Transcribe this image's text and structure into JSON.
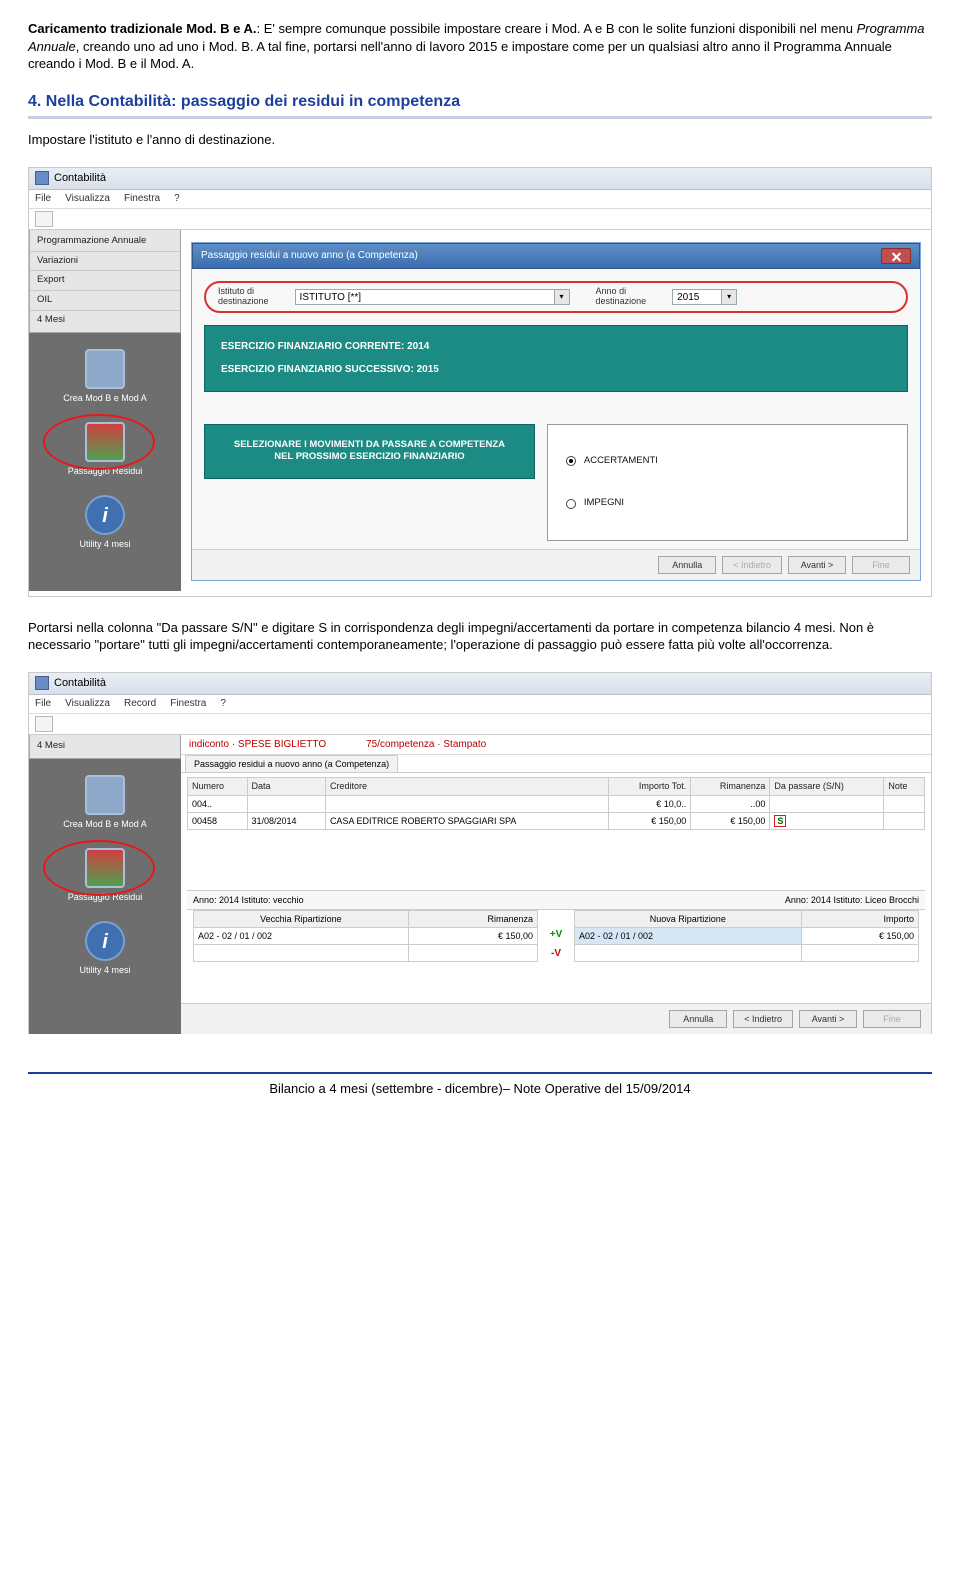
{
  "intro": {
    "strong": "Caricamento tradizionale Mod. B e A.",
    "text1": ": E' sempre comunque possibile impostare creare i Mod. A e B con le solite funzioni disponibili nel menu ",
    "em": "Programma Annuale",
    "text2": ", creando uno ad uno i Mod. B. A tal fine, portarsi nell'anno di lavoro 2015 e impostare come per un qualsiasi altro anno il Programma Annuale creando i Mod. B e il Mod. A."
  },
  "section": {
    "title": "4. Nella Contabilità: passaggio dei residui in competenza",
    "lead": "Impostare l'istituto e l'anno di destinazione."
  },
  "shot1": {
    "app_title": "Contabilità",
    "menu": [
      "File",
      "Visualizza",
      "Finestra",
      "?"
    ],
    "leftmenu": [
      "Programmazione Annuale",
      "Variazioni",
      "Export",
      "OIL",
      "4 Mesi"
    ],
    "sidebar": {
      "crea_label": "Crea Mod B e Mod A",
      "passaggio_label": "Passaggio Residui",
      "utility_label": "Utility 4 mesi"
    },
    "dialog": {
      "title": "Passaggio residui a nuovo anno (a Competenza)",
      "fld_ist_lbl": "Istituto di\ndestinazione",
      "fld_ist_val": "ISTITUTO [**]",
      "fld_anno_lbl": "Anno di\ndestinazione",
      "fld_anno_val": "2015",
      "teal1a": "ESERCIZIO FINANZIARIO CORRENTE: 2014",
      "teal1b": "ESERCIZIO FINANZIARIO SUCCESSIVO: 2015",
      "teal2a": "SELEZIONARE I MOVIMENTI DA PASSARE A COMPETENZA",
      "teal2b": "NEL PROSSIMO ESERCIZIO FINANZIARIO",
      "radio1": "ACCERTAMENTI",
      "radio2": "IMPEGNI",
      "btns": [
        "Annulla",
        "< Indietro",
        "Avanti >",
        "Fine"
      ]
    }
  },
  "mid_text": {
    "p1": "Portarsi nella colonna \"Da passare S/N\" e digitare S in corrispondenza degli impegni/accertamenti da portare in competenza bilancio 4 mesi. Non è necessario \"portare\" tutti gli impegni/accertamenti contemporaneamente; l'operazione di passaggio può essere fatta più volte all'occorrenza."
  },
  "shot2": {
    "app_title": "Contabilità",
    "menu": [
      "File",
      "Visualizza",
      "Record",
      "Finestra",
      "?"
    ],
    "leftmenu": [
      "4 Mesi"
    ],
    "sidebar": {
      "crea_label": "Crea Mod B e Mod A",
      "passaggio_label": "Passaggio Residui",
      "utility_label": "Utility 4 mesi"
    },
    "tabs": {
      "tab1": "Passaggio residui a nuovo anno (a Competenza)"
    },
    "redbar": {
      "left": "indiconto · SPESE BIGLIETTO",
      "right": "75/competenza · Stampato"
    },
    "table": {
      "headers": [
        "Numero",
        "Data",
        "Creditore",
        "Importo Tot.",
        "Rimanenza",
        "Da passare (S/N)",
        "Note"
      ],
      "rows": [
        {
          "num": "004..",
          "data": "",
          "cred": "",
          "tot": "€ 10,0..",
          "rim": "..00",
          "pass": "",
          "note": ""
        },
        {
          "num": "00458",
          "data": "31/08/2014",
          "cred": "CASA EDITRICE ROBERTO SPAGGIARI SPA",
          "tot": "€ 150,00",
          "rim": "€ 150,00",
          "pass": "S",
          "note": ""
        }
      ]
    },
    "sub": {
      "left": "Anno: 2014  Istituto: vecchio",
      "right": "Anno: 2014  Istituto: Liceo Brocchi"
    },
    "bottom_left": {
      "h1": "Vecchia Ripartizione",
      "h2": "Rimanenza",
      "v1": "A02 - 02 / 01 / 002",
      "v2": "€ 150,00"
    },
    "bottom_right": {
      "h1": "Nuova Ripartizione",
      "h2": "Importo",
      "v1": "A02 - 02 / 01 / 002",
      "v2": "€ 150,00"
    },
    "btns": [
      "Annulla",
      "< Indietro",
      "Avanti >",
      "Fine"
    ]
  },
  "footer": "Bilancio a 4 mesi (settembre - dicembre)– Note Operative del 15/09/2014"
}
